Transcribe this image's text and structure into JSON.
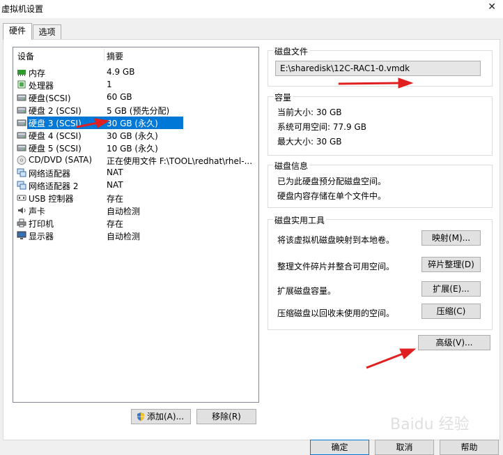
{
  "window": {
    "title": "虚拟机设置",
    "close_glyph": "✕"
  },
  "tabs": [
    {
      "label": "硬件"
    },
    {
      "label": "选项"
    }
  ],
  "devices": {
    "col_device": "设备",
    "col_summary": "摘要",
    "items": [
      {
        "name": "内存",
        "summary": "4.9 GB",
        "icon": "memory-icon"
      },
      {
        "name": "处理器",
        "summary": "1",
        "icon": "processor-icon"
      },
      {
        "name": "硬盘(SCSI)",
        "summary": "60 GB",
        "icon": "harddisk-icon"
      },
      {
        "name": "硬盘 2 (SCSI)",
        "summary": "5 GB (预先分配)",
        "icon": "harddisk-icon"
      },
      {
        "name": "硬盘 3 (SCSI)",
        "summary": "30 GB (永久)",
        "icon": "harddisk-icon"
      },
      {
        "name": "硬盘 4 (SCSI)",
        "summary": "30 GB (永久)",
        "icon": "harddisk-icon"
      },
      {
        "name": "硬盘 5 (SCSI)",
        "summary": "10 GB (永久)",
        "icon": "harddisk-icon"
      },
      {
        "name": "CD/DVD (SATA)",
        "summary": "正在使用文件 F:\\TOOL\\redhat\\rhel-...",
        "icon": "cd-dvd-icon"
      },
      {
        "name": "网络适配器",
        "summary": "NAT",
        "icon": "network-adapter-icon"
      },
      {
        "name": "网络适配器 2",
        "summary": "NAT",
        "icon": "network-adapter-icon"
      },
      {
        "name": "USB 控制器",
        "summary": "存在",
        "icon": "usb-icon"
      },
      {
        "name": "声卡",
        "summary": "自动检测",
        "icon": "sound-card-icon"
      },
      {
        "name": "打印机",
        "summary": "存在",
        "icon": "printer-icon"
      },
      {
        "name": "显示器",
        "summary": "自动检测",
        "icon": "display-icon"
      }
    ],
    "selected_index": 4
  },
  "buttons": {
    "add": "添加(A)...",
    "remove": "移除(R)",
    "ok": "确定",
    "cancel": "取消",
    "help": "帮助",
    "advanced": "高级(V)..."
  },
  "disk_file": {
    "group": "磁盘文件",
    "path": "E:\\sharedisk\\12C-RAC1-0.vmdk"
  },
  "capacity": {
    "group": "容量",
    "current": "当前大小: 30 GB",
    "available": "系统可用空间: 77.9 GB",
    "max": "最大大小: 30 GB"
  },
  "disk_info": {
    "group": "磁盘信息",
    "line1": "已为此硬盘预分配磁盘空间。",
    "line2": "硬盘内容存储在单个文件中。"
  },
  "utilities": {
    "group": "磁盘实用工具",
    "map_desc": "将该虚拟机磁盘映射到本地卷。",
    "map_btn": "映射(M)...",
    "defrag_desc": "整理文件碎片并整合可用空间。",
    "defrag_btn": "碎片整理(D)",
    "expand_desc": "扩展磁盘容量。",
    "expand_btn": "扩展(E)...",
    "compact_desc": "压缩磁盘以回收未使用的空间。",
    "compact_btn": "压缩(C)"
  },
  "watermark": "Baidu 经验",
  "colors": {
    "selection": "#0078d7",
    "annotation_arrow": "#e02020"
  }
}
